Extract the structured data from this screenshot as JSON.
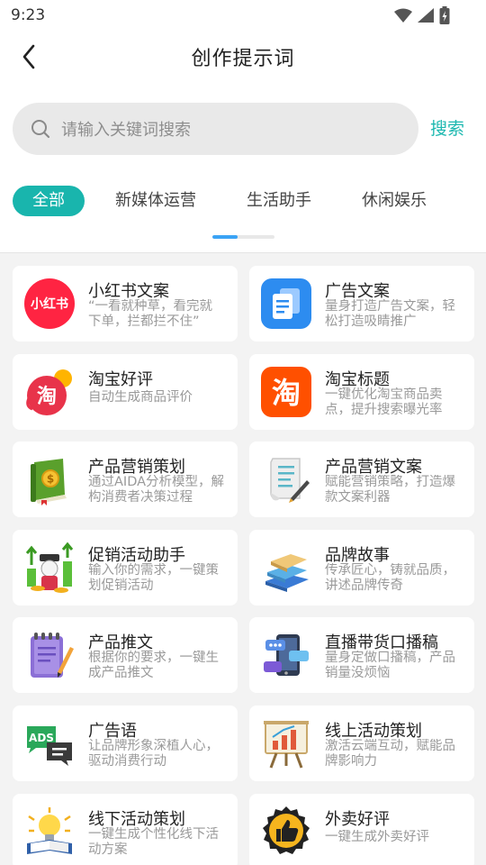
{
  "status_bar": {
    "time": "9:23"
  },
  "header": {
    "title": "创作提示词"
  },
  "search": {
    "placeholder": "请输入关键词搜索",
    "button_label": "搜索"
  },
  "tabs": [
    {
      "label": "全部",
      "active": true
    },
    {
      "label": "新媒体运营",
      "active": false
    },
    {
      "label": "生活助手",
      "active": false
    },
    {
      "label": "休闲娱乐",
      "active": false
    }
  ],
  "tab_scroll_progress": 0.4,
  "icon_text": {
    "xiaohongshu": "小红书",
    "taobao": "淘"
  },
  "cards": [
    {
      "title": "小红书文案",
      "desc": "“一看就种草，看完就下单，拦都拦不住”",
      "icon": "xiaohongshu-logo-icon"
    },
    {
      "title": "广告文案",
      "desc": "量身打造广告文案，轻松打造吸睛推广",
      "icon": "copy-document-icon"
    },
    {
      "title": "淘宝好评",
      "desc": "自动生成商品评价",
      "icon": "taobao-review-icon"
    },
    {
      "title": "淘宝标题",
      "desc": "一键优化淘宝商品卖点，提升搜索曝光率",
      "icon": "taobao-logo-icon"
    },
    {
      "title": "产品营销策划",
      "desc": "通过AIDA分析模型，解构消费者决策过程",
      "icon": "money-book-icon"
    },
    {
      "title": "产品营销文案",
      "desc": "赋能营销策略，打造爆款文案利器",
      "icon": "scroll-pen-icon"
    },
    {
      "title": "促销活动助手",
      "desc": "输入你的需求，一键策划促销活动",
      "icon": "promotion-growth-icon"
    },
    {
      "title": "品牌故事",
      "desc": "传承匠心，铸就品质，讲述品牌传奇",
      "icon": "book-stack-icon"
    },
    {
      "title": "产品推文",
      "desc": "根据你的要求，一键生成产品推文",
      "icon": "notepad-pencil-icon"
    },
    {
      "title": "直播带货口播稿",
      "desc": "量身定做口播稿，产品销量没烦恼",
      "icon": "live-chat-phone-icon"
    },
    {
      "title": "广告语",
      "desc": "让品牌形象深植人心，驱动消费行动",
      "icon": "ads-chat-icon"
    },
    {
      "title": "线上活动策划",
      "desc": "激活云端互动，赋能品牌影响力",
      "icon": "presentation-board-icon"
    },
    {
      "title": "线下活动策划",
      "desc": "一键生成个性化线下活动方案",
      "icon": "lightbulb-book-icon"
    },
    {
      "title": "外卖好评",
      "desc": "一键生成外卖好评",
      "icon": "thumbs-up-badge-icon"
    }
  ]
}
